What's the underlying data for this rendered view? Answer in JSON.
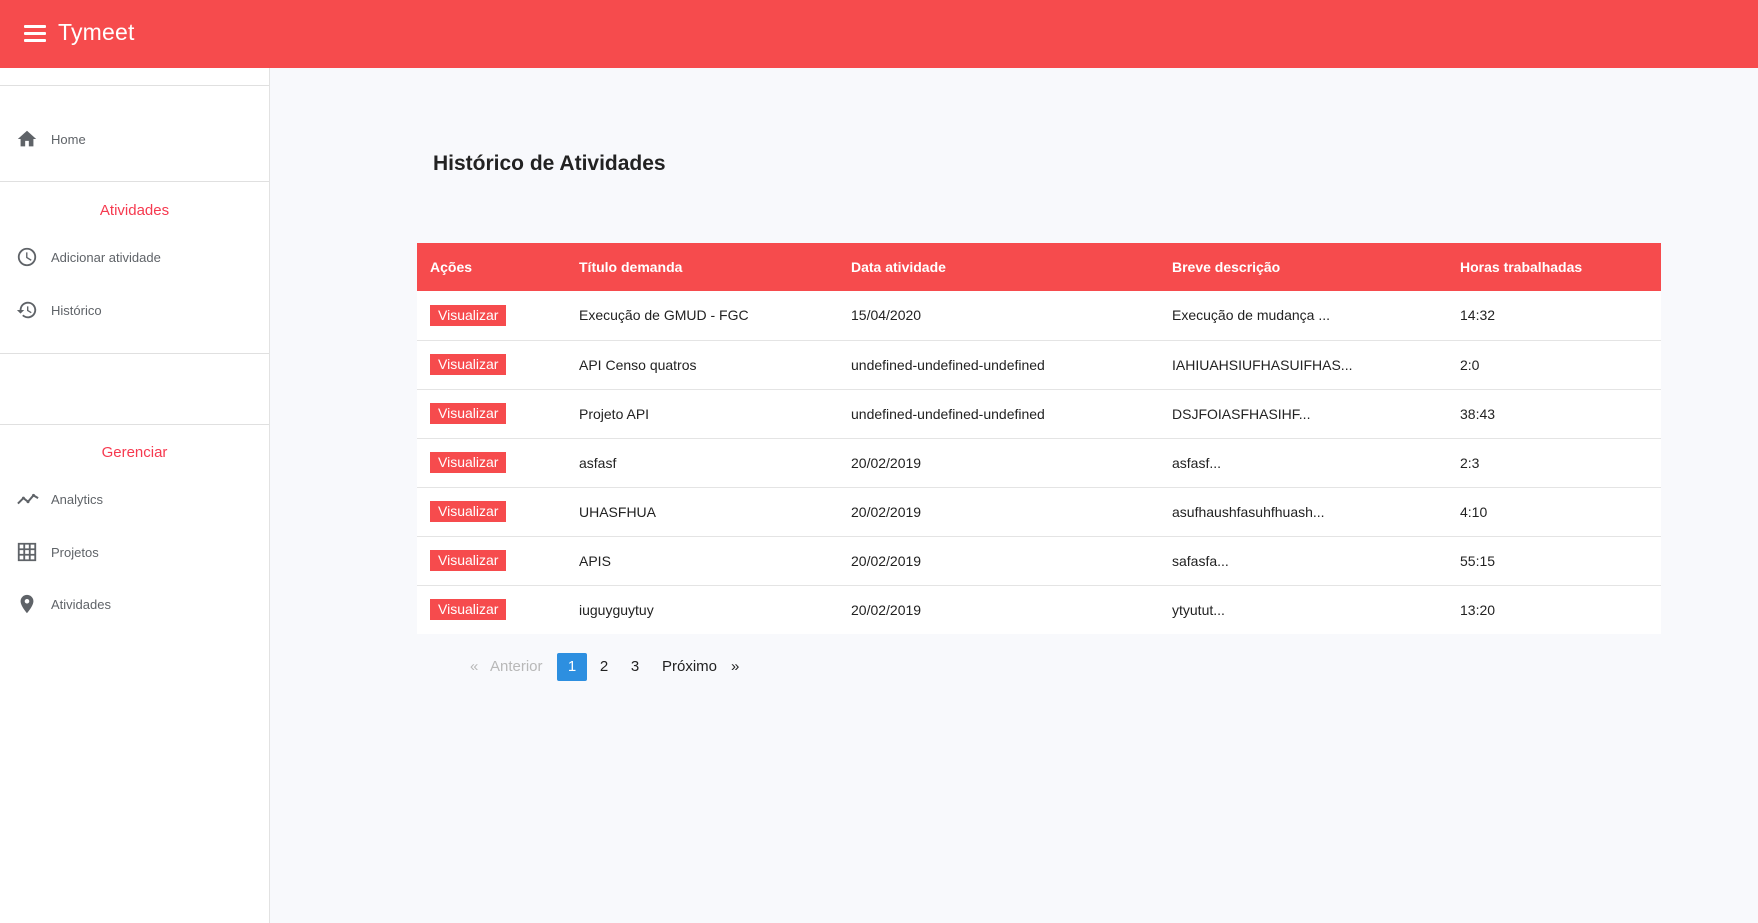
{
  "app": {
    "title": "Tymeet"
  },
  "sidebar": {
    "home_label": "Home",
    "section_atividades": "Atividades",
    "add_atividade_label": "Adicionar atividade",
    "historico_label": "Histórico",
    "section_gerenciar": "Gerenciar",
    "analytics_label": "Analytics",
    "projetos_label": "Projetos",
    "atividades_label": "Atividades"
  },
  "main": {
    "title": "Histórico de Atividades",
    "columns": [
      "Ações",
      "Título demanda",
      "Data atividade",
      "Breve descrição",
      "Horas trabalhadas"
    ],
    "action_label": "Visualizar",
    "rows": [
      {
        "titulo": "Execução de GMUD - FGC",
        "data": "15/04/2020",
        "descricao": "Execução de mudança ...",
        "horas": "14:32"
      },
      {
        "titulo": "API Censo quatros",
        "data": "undefined-undefined-undefined",
        "descricao": "IAHIUAHSIUFHASUIFHAS...",
        "horas": "2:0"
      },
      {
        "titulo": "Projeto API",
        "data": "undefined-undefined-undefined",
        "descricao": "DSJFOIASFHASIHF...",
        "horas": "38:43"
      },
      {
        "titulo": "asfasf",
        "data": "20/02/2019",
        "descricao": "asfasf...",
        "horas": "2:3"
      },
      {
        "titulo": "UHASFHUA",
        "data": "20/02/2019",
        "descricao": "asufhaushfasuhfhuash...",
        "horas": "4:10"
      },
      {
        "titulo": "APIS",
        "data": "20/02/2019",
        "descricao": "safasfa...",
        "horas": "55:15"
      },
      {
        "titulo": "iuguyguytuy",
        "data": "20/02/2019",
        "descricao": "ytyutut...",
        "horas": "13:20"
      }
    ]
  },
  "pagination": {
    "prev_arrow": "«",
    "prev_label": "Anterior",
    "pages": [
      "1",
      "2",
      "3"
    ],
    "current": "1",
    "next_label": "Próximo",
    "next_arrow": "»"
  },
  "colors": {
    "brand": "#f64b4d",
    "section": "#f6394f",
    "active_page": "#2d8fe0"
  }
}
